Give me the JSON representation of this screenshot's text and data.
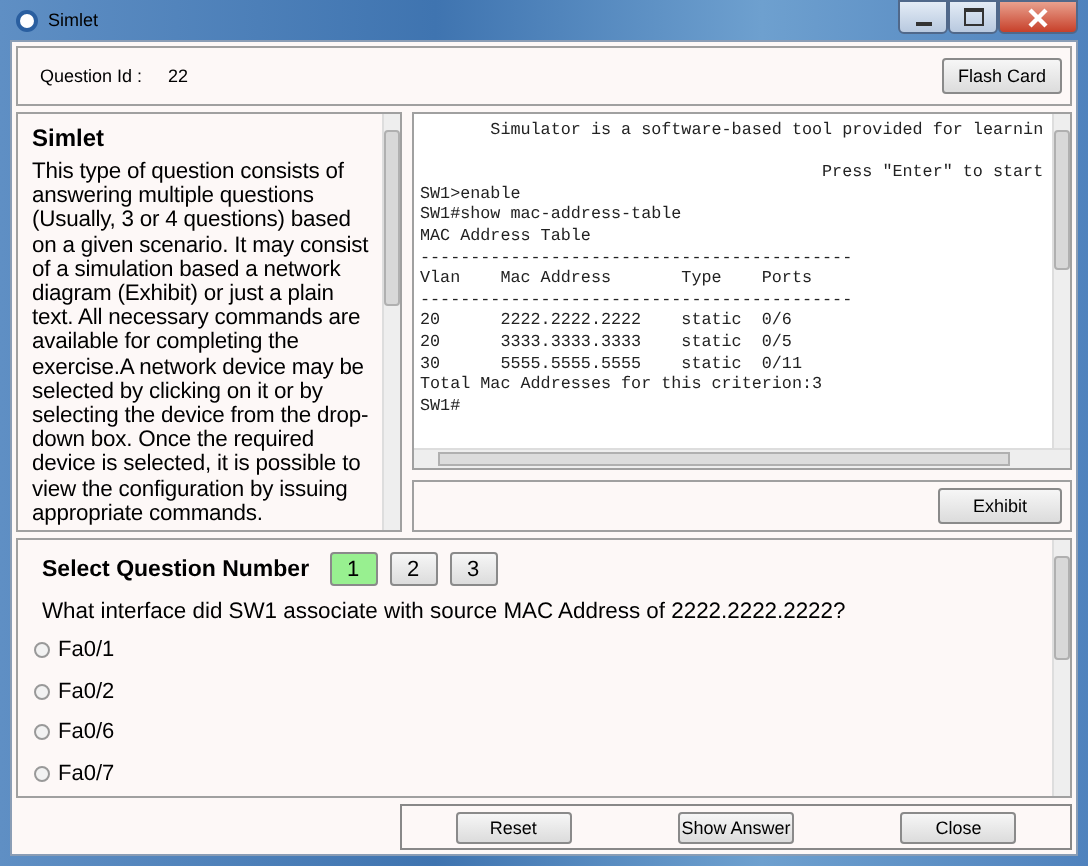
{
  "window": {
    "title": "Simlet"
  },
  "header": {
    "label": "Question Id :",
    "value": "22",
    "button": "Flash Card"
  },
  "description": {
    "title": "Simlet",
    "text": "This type of question consists of answering multiple questions (Usually, 3 or 4 questions) based on a given scenario. It may consist of a simulation based a network diagram (Exhibit) or just a plain text.  All necessary commands are available for completing the exercise.A network device may be selected by clicking on it or by selecting the device from the drop-down box. Once the required device is selected, it is possible to view the configuration by issuing appropriate commands."
  },
  "terminal": {
    "lines": [
      "       Simulator is a software-based tool provided for learnin",
      "                                        Press \"Enter\" to start",
      "SW1>enable",
      "SW1#show mac-address-table",
      "MAC Address Table",
      "-------------------------------------------",
      "Vlan    Mac Address       Type    Ports",
      "-------------------------------------------",
      "20      2222.2222.2222    static  0/6",
      "20      3333.3333.3333    static  0/5",
      "30      5555.5555.5555    static  0/11",
      "Total Mac Addresses for this criterion:3",
      "SW1#"
    ]
  },
  "exhibit_button": "Exhibit",
  "question_selector": {
    "label": "Select Question Number",
    "numbers": [
      {
        "label": "1",
        "selected": true
      },
      {
        "label": "2",
        "selected": false
      },
      {
        "label": "3",
        "selected": false
      }
    ]
  },
  "question": "What interface did SW1 associate with source MAC Address of 2222.2222.2222?",
  "options": [
    {
      "label": "Fa0/1",
      "selected": false
    },
    {
      "label": "Fa0/2",
      "selected": false
    },
    {
      "label": "Fa0/6",
      "selected": false
    },
    {
      "label": "Fa0/7",
      "selected": false
    }
  ],
  "buttons": [
    "Reset",
    "Show Answer",
    "Close"
  ]
}
